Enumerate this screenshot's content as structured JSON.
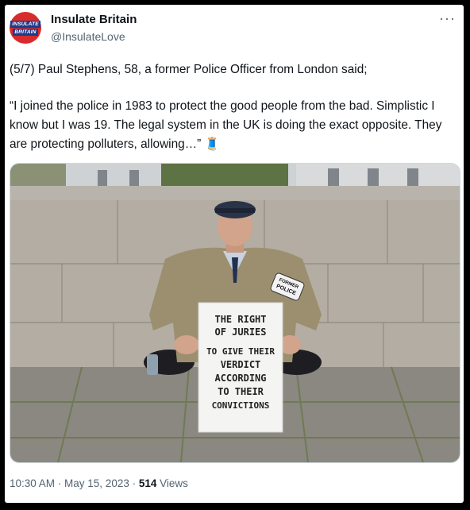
{
  "account": {
    "name": "Insulate Britain",
    "handle": "@InsulateLove",
    "avatar_line1": "INSULATE",
    "avatar_line2": "BRITAIN"
  },
  "tweet": {
    "line1": "(5/7) Paul Stephens, 58, a former Police Officer from London said;",
    "quote": "“I joined the police in 1983 to protect the good people from the bad. Simplistic I know but I was 19. The legal system in the UK is doing the exact opposite. They are protecting polluters, allowing…” 🧵",
    "more_icon": "···"
  },
  "photo": {
    "sign_lines": [
      "THE RIGHT",
      "OF JURIES",
      "TO GIVE THEIR",
      "VERDICT",
      "ACCORDING",
      "TO THEIR",
      "CONVICTIONS"
    ],
    "armband_line1": "FORMER",
    "armband_line2": "POLICE"
  },
  "meta": {
    "timestamp": "10:30 AM · May 15, 2023 · ",
    "views_count": "514",
    "views_label": " Views"
  },
  "colors": {
    "avatar_red": "#d92b2b",
    "avatar_blue": "#1f3a8a",
    "secondary_text": "#536471"
  }
}
